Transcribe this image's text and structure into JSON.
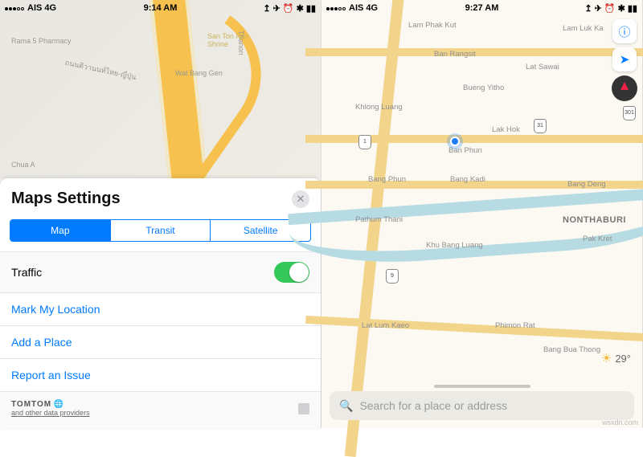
{
  "left": {
    "status": {
      "carrier": "AIS",
      "network": "4G",
      "time": "9:14 AM"
    },
    "map_pois": {
      "pharmacy": "Rama 5 Pharmacy",
      "temple": "Wat Bang Gen",
      "road_label": "Thanon",
      "thai_road": "ถนนติวานนท์ไทย-ญี่ปุ่น",
      "landmark": "Chua A"
    },
    "card": {
      "title": "Maps Settings",
      "segments": {
        "map": "Map",
        "transit": "Transit",
        "satellite": "Satellite"
      },
      "traffic_label": "Traffic",
      "traffic_on": true,
      "links": {
        "mark": "Mark My Location",
        "add": "Add a Place",
        "report": "Report an Issue"
      },
      "attribution": {
        "brand": "TOMTOM",
        "line": "and other data providers"
      }
    }
  },
  "right": {
    "status": {
      "carrier": "AIS",
      "network": "4G",
      "time": "9:27 AM"
    },
    "places": {
      "lam_phak_kut": "Lam Phak Kut",
      "lam_luk_ka": "Lam Luk Ka",
      "ban_rangsit": "Ban Rangsit",
      "lat_sawai": "Lat Sawai",
      "bueng_yitho": "Bueng Yitho",
      "khlong_luang": "Khlong Luang",
      "lak_hok": "Lak Hok",
      "ban_phun": "Ban Phun",
      "bang_kadi": "Bang Kadi",
      "bang_phun": "Bang Phun",
      "bang_deng": "Bang Deng",
      "pathum": "Pathum Thani",
      "khu_bang_luang": "Khu Bang Luang",
      "nonthaburi": "NONTHABURI",
      "pak_kret": "Pak Kret",
      "lat_lum_kaeo": "Lat Lum Kaeo",
      "phimon_rat": "Phimon Rat",
      "bang_bua_thong": "Bang Bua Thong"
    },
    "shields": {
      "r1": "1",
      "r31": "31",
      "r9": "9",
      "r301": "301"
    },
    "weather": {
      "temp": "29°"
    },
    "search_placeholder": "Search for a place or address"
  },
  "watermark": "wsxdn.com"
}
